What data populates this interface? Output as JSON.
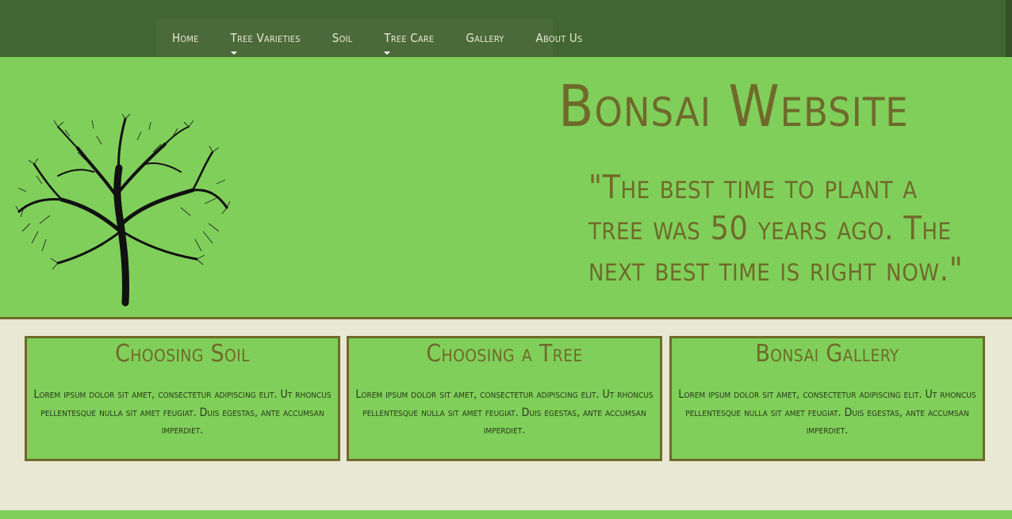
{
  "nav": {
    "items": [
      {
        "label": "Home",
        "dropdown": false
      },
      {
        "label": "Tree Varieties",
        "dropdown": true
      },
      {
        "label": "Soil",
        "dropdown": false
      },
      {
        "label": "Tree Care",
        "dropdown": true
      },
      {
        "label": "Gallery",
        "dropdown": false
      },
      {
        "label": "About Us",
        "dropdown": false
      }
    ]
  },
  "hero": {
    "title": "Bonsai Website",
    "quote": "\"The best time to plant a tree was 50 years ago. The next best time is right now.\"",
    "image": "tree-silhouette"
  },
  "cards": [
    {
      "title": "Choosing Soil",
      "body": "Lorem ipsum dolor sit amet, consectetur adipiscing elit. Ut rhoncus pellentesque nulla sit amet feugiat. Duis egestas, ante accumsan imperdiet."
    },
    {
      "title": "Choosing a Tree",
      "body": "Lorem ipsum dolor sit amet, consectetur adipiscing elit. Ut rhoncus pellentesque nulla sit amet feugiat. Duis egestas, ante accumsan imperdiet."
    },
    {
      "title": "Bonsai Gallery",
      "body": "Lorem ipsum dolor sit amet, consectetur adipiscing elit. Ut rhoncus pellentesque nulla sit amet feugiat. Duis egestas, ante accumsan imperdiet."
    }
  ],
  "colors": {
    "topbar": "#426631",
    "nav": "#4b6a3a",
    "hero": "#80cf5a",
    "accent_text": "#6f6a2b",
    "page_bg": "#e9e8d4"
  }
}
